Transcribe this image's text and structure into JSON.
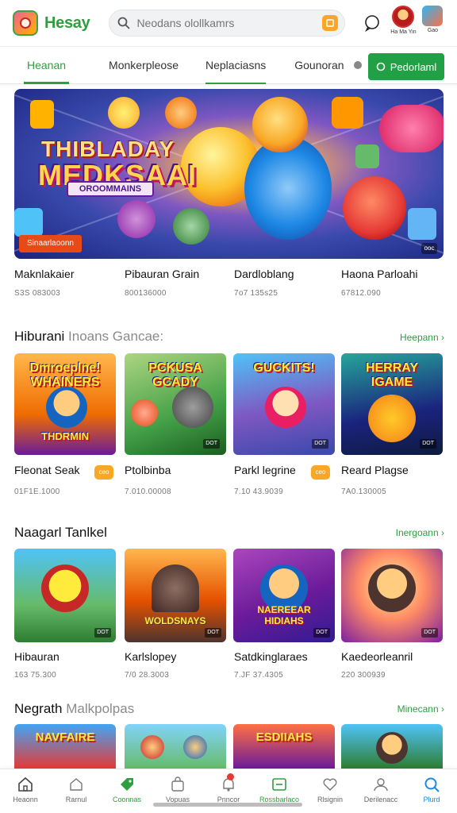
{
  "app": {
    "brand": "Hesay"
  },
  "search": {
    "placeholder": "Neodans olollkamrs"
  },
  "header": {
    "avatar_caption": "Ha Ma Yin",
    "thumb_caption": "Gao"
  },
  "nav": {
    "tabs": [
      {
        "label": "Heanan",
        "active": true
      },
      {
        "label": "Monkerpleose",
        "active": false
      },
      {
        "label": "Neplaciasns",
        "active": false
      },
      {
        "label": "Gounoran",
        "active": false
      }
    ],
    "button_label": "Pedorlaml"
  },
  "hero": {
    "title_line1": "THIBLADAY",
    "title_line2": "MEDKSAAI",
    "title_line3": "OROOMMAINS",
    "badge": "Sinaarlaoonn",
    "page_indicator": "ooc",
    "captions": [
      {
        "title": "Maknlakaier",
        "sub": "S3S 083003"
      },
      {
        "title": "Pibauran Grain",
        "sub": "800136000"
      },
      {
        "title": "Dardloblang",
        "sub": "7o7 135s25"
      },
      {
        "title": "Haona Parloahi",
        "sub": "67812.090"
      }
    ]
  },
  "sections": [
    {
      "title": "Hiburani",
      "title_muted": "Inoans Gancae:",
      "more": "Heepann",
      "cards": [
        {
          "art": "Dmroeplne! WHAINERS",
          "art2": "THDRMIN",
          "title": "Fleonat Seak",
          "sub": "01F1E.1000",
          "badge": "ceo",
          "tag": ""
        },
        {
          "art": "PCKUSA GCADY",
          "art2": "",
          "title": "Ptolbinba",
          "sub": "7.010.00008",
          "badge": "",
          "tag": "DOT"
        },
        {
          "art": "GUCKITS!",
          "art2": "",
          "title": "Parkl legrine",
          "sub": "7.10 43.9039",
          "badge": "ceo",
          "tag": "DOT"
        },
        {
          "art": "HERRAY IGAME",
          "art2": "",
          "title": "Reard Plagse",
          "sub": "7A0.130005",
          "badge": "",
          "tag": "DOT"
        }
      ]
    },
    {
      "title": "Naagarl Tanlkel",
      "title_muted": "",
      "more": "Inergoann",
      "cards": [
        {
          "art": "",
          "title": "Hibauran",
          "sub": "163 75.300",
          "tag": "DOT"
        },
        {
          "art": "WOLDSNAYS",
          "title": "Karlslopey",
          "sub": "7/0 28.3003",
          "tag": "DOT"
        },
        {
          "art": "NAEREEAR HIDIAHS",
          "title": "Satdkinglaraes",
          "sub": "7.JF 37.4305",
          "tag": "DOT"
        },
        {
          "art": "",
          "title": "Kaedeorleanril",
          "sub": "220 300939",
          "tag": "DOT"
        }
      ]
    },
    {
      "title": "Negrath",
      "title_muted": "Malkpolpas",
      "more": "Minecann",
      "cards": [
        {
          "art": "NAVFAIRE"
        },
        {
          "art": ""
        },
        {
          "art": "ESDIIAHS"
        },
        {
          "art": ""
        }
      ]
    }
  ],
  "bottom_nav": [
    {
      "label": "Heaonn",
      "icon": "home-icon",
      "active": false
    },
    {
      "label": "Rarnul",
      "icon": "home-outline-icon",
      "active": false
    },
    {
      "label": "Coonnas",
      "icon": "tag-icon",
      "active": true
    },
    {
      "label": "Vopuas",
      "icon": "bag-icon",
      "active": false
    },
    {
      "label": "Pnncor",
      "icon": "bell-icon",
      "active": false,
      "notification": true
    },
    {
      "label": "Rossbarlaco",
      "icon": "game-icon",
      "active": true
    },
    {
      "label": "Rlsignin",
      "icon": "heart-icon",
      "active": false
    },
    {
      "label": "Derilenacc",
      "icon": "user-icon",
      "active": false
    },
    {
      "label": "Plurd",
      "icon": "search-icon",
      "active": false,
      "blue": true
    }
  ],
  "colors": {
    "accent": "#2e9e3f",
    "badge": "#f9a825",
    "hero_badge": "#e64a19"
  }
}
